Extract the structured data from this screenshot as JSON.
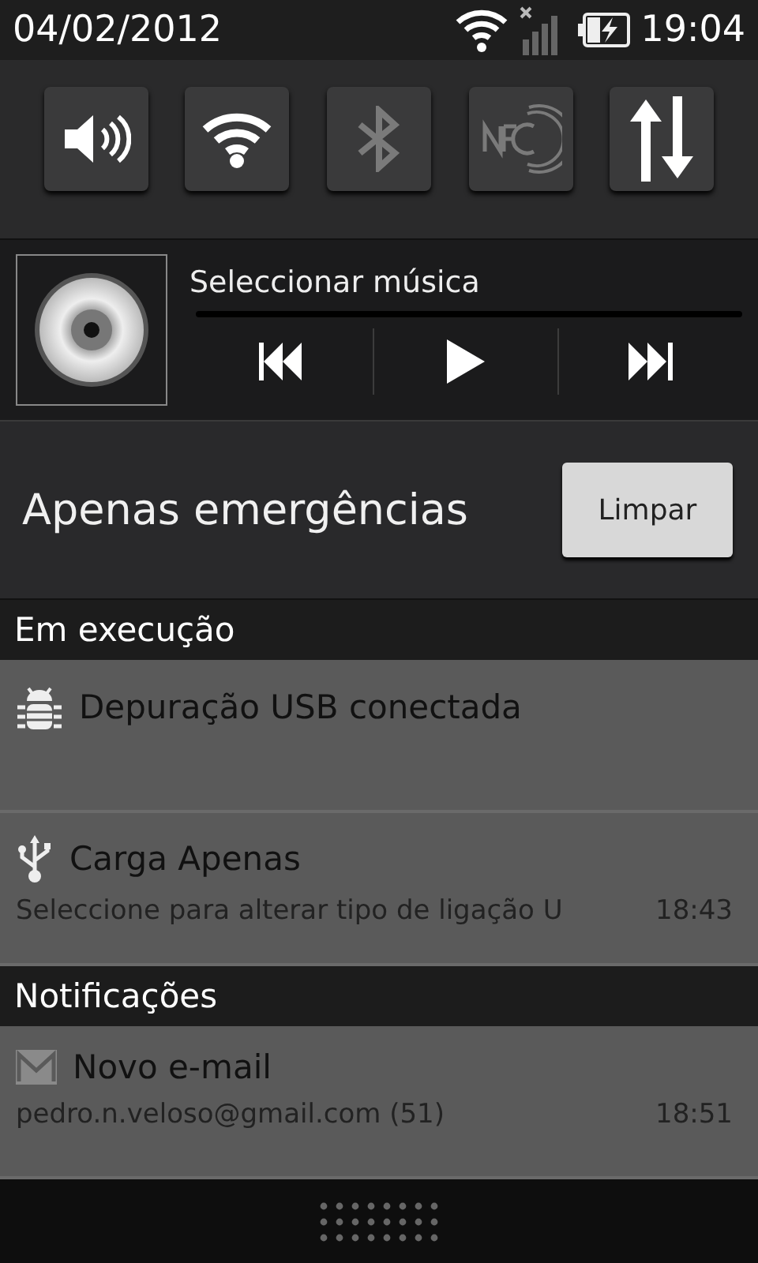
{
  "status_bar": {
    "date": "04/02/2012",
    "time": "19:04"
  },
  "toggles": [
    {
      "kind": "sound",
      "on": true
    },
    {
      "kind": "wifi",
      "on": true
    },
    {
      "kind": "bluetooth",
      "on": false
    },
    {
      "kind": "nfc",
      "on": false
    },
    {
      "kind": "data",
      "on": true
    }
  ],
  "music": {
    "title": "Seleccionar música"
  },
  "carrier": {
    "label": "Apenas emergências",
    "button": "Limpar"
  },
  "sections": [
    {
      "title": "Em execução",
      "items": [
        {
          "kind": "debug",
          "title": "Depuração USB conectada"
        },
        {
          "kind": "usb",
          "title": "Carga Apenas",
          "text": "Seleccione para alterar tipo de ligação U",
          "time": "18:43"
        }
      ]
    },
    {
      "title": "Notificações",
      "items": [
        {
          "kind": "mail",
          "title": "Novo e-mail",
          "text": "pedro.n.veloso@gmail.com (51)",
          "time": "18:51"
        }
      ]
    }
  ]
}
